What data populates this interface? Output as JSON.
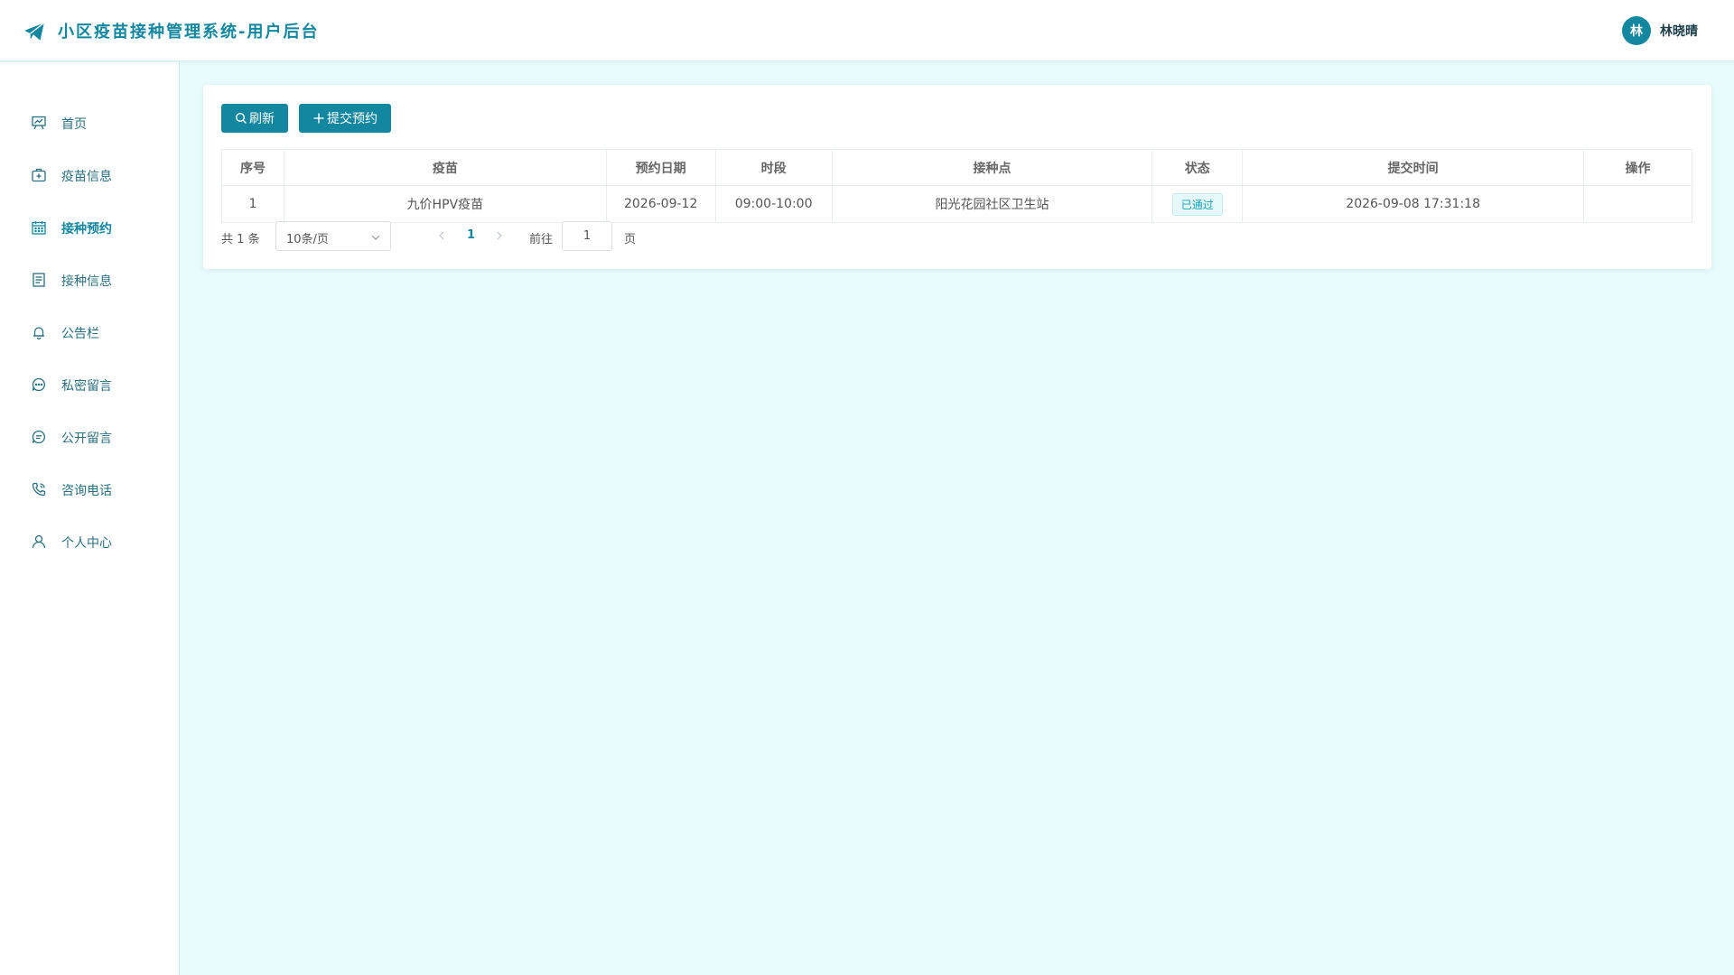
{
  "header": {
    "title": "小区疫苗接种管理系统-用户后台",
    "user": {
      "avatar_letter": "林",
      "name": "林晓晴"
    }
  },
  "colors": {
    "accent": "#13879f",
    "background": "#e8fcfd",
    "badge_text": "#13a4b5"
  },
  "sidebar": {
    "items": [
      {
        "label": "首页",
        "icon": "presentation-chart-icon",
        "active": false
      },
      {
        "label": "疫苗信息",
        "icon": "medical-kit-icon",
        "active": false
      },
      {
        "label": "接种预约",
        "icon": "calendar-icon",
        "active": true
      },
      {
        "label": "接种信息",
        "icon": "document-list-icon",
        "active": false
      },
      {
        "label": "公告栏",
        "icon": "bell-icon",
        "active": false
      },
      {
        "label": "私密留言",
        "icon": "chat-dots-icon",
        "active": false
      },
      {
        "label": "公开留言",
        "icon": "chat-lines-icon",
        "active": false
      },
      {
        "label": "咨询电话",
        "icon": "phone-icon",
        "active": false
      },
      {
        "label": "个人中心",
        "icon": "user-icon",
        "active": false
      }
    ]
  },
  "toolbar": {
    "refresh_label": "刷新",
    "submit_label": "提交预约"
  },
  "table": {
    "columns": [
      "序号",
      "疫苗",
      "预约日期",
      "时段",
      "接种点",
      "状态",
      "提交时间",
      "操作"
    ],
    "rows": [
      {
        "index": "1",
        "vaccine": "九价HPV疫苗",
        "date": "2026-09-12",
        "period": "09:00-10:00",
        "site": "阳光花园社区卫生站",
        "status": "已通过",
        "submitted": "2026-09-08 17:31:18",
        "actions": ""
      }
    ]
  },
  "pagination": {
    "total_text": "共 1 条",
    "page_size": "10条/页",
    "current_page": "1",
    "goto_label": "前往",
    "goto_value": "1",
    "page_unit": "页"
  }
}
